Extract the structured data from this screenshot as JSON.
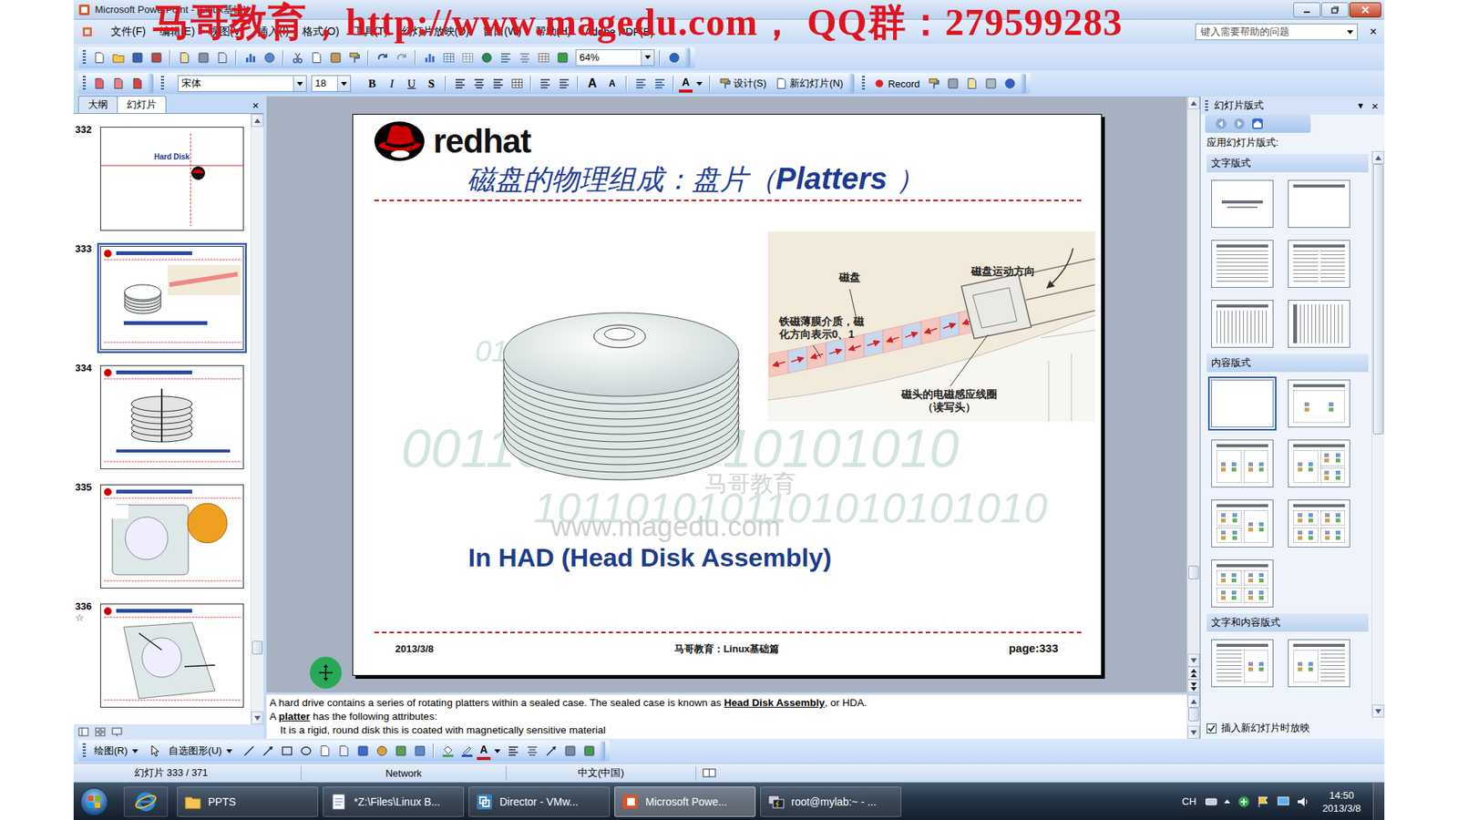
{
  "window": {
    "title": "Microsoft PowerPoint - [Linux基础]"
  },
  "watermark": "马哥教育，http://www.magedu.com， QQ群：279599283",
  "menu": [
    "文件(F)",
    "编辑(E)",
    "视图(V)",
    "插入(I)",
    "格式(O)",
    "工具(T)",
    "幻灯片放映(D)",
    "窗口(W)",
    "帮助(H)",
    "Adobe PDF(B)"
  ],
  "help_box": {
    "placeholder": "键入需要帮助的问题",
    "close": "×"
  },
  "standard_toolbar": {
    "zoom": "64%"
  },
  "format_toolbar": {
    "font": "宋体",
    "size": "18",
    "styles": [
      {
        "label": "B",
        "kind": "bold"
      },
      {
        "label": "I",
        "kind": "italic"
      },
      {
        "label": "U",
        "kind": "underline"
      },
      {
        "label": "S",
        "kind": "shadow"
      }
    ],
    "size_buttons": [
      "A",
      "A"
    ],
    "font_color": "A",
    "design": "设计(S)",
    "new_slide": "新幻灯片(N)",
    "record": "Record"
  },
  "sidebar": {
    "tabs": [
      {
        "label": "大纲",
        "selected": false
      },
      {
        "label": "幻灯片",
        "selected": true
      }
    ],
    "close": "×",
    "scroll_position": 0.9,
    "thumbnails": [
      {
        "number": "332",
        "kind": "section",
        "caption": "Hard Disk",
        "selected": false
      },
      {
        "number": "333",
        "kind": "platters",
        "selected": true
      },
      {
        "number": "334",
        "kind": "spindle",
        "selected": false
      },
      {
        "number": "335",
        "kind": "drive",
        "selected": false
      },
      {
        "number": "336",
        "kind": "actuator",
        "selected": false,
        "mark": "☆"
      }
    ]
  },
  "slide": {
    "logo": "redhat",
    "title": [
      {
        "text": "磁盘的物理组成：盘片（",
        "latin": false
      },
      {
        "text": "Platters",
        "latin": true
      },
      {
        "text": " ）",
        "latin": false
      }
    ],
    "wm_lines": [
      "0101101010101101",
      "0011010101010101010",
      "1011010101101010101010"
    ],
    "wm_brand": "马哥教育",
    "wm_site": "www.magedu.com",
    "diagram": {
      "disk": "磁盘",
      "direction": "磁盘运动方向",
      "medium": [
        "铁磁薄膜介质，磁",
        "化方向表示0、1"
      ],
      "head": [
        "磁头的电磁感应线圈",
        "（读写头）"
      ]
    },
    "caption": "In HAD (Head Disk Assembly)",
    "footer": {
      "date": "2013/3/8",
      "center": "马哥教育：Linux基础篇",
      "page": "page:333"
    },
    "scroll_position": 0.86
  },
  "notes": [
    {
      "indent": false,
      "parts": [
        {
          "text": "A hard drive contains a series of rotating platters within a sealed case. The sealed case is known as ",
          "bold": false
        },
        {
          "text": "Head Disk Assembly",
          "bold": true
        },
        {
          "text": ", or HDA.",
          "bold": false
        }
      ]
    },
    {
      "indent": false,
      "parts": [
        {
          "text": "A ",
          "bold": false
        },
        {
          "text": "platter",
          "bold": true
        },
        {
          "text": " has the following attributes:",
          "bold": false
        }
      ]
    },
    {
      "indent": true,
      "parts": [
        {
          "text": "It is a rigid, round disk this is coated with magnetically sensitive material",
          "bold": false
        }
      ]
    }
  ],
  "task_pane": {
    "title": "幻灯片版式",
    "dropdown": "▼",
    "close": "×",
    "label": "应用幻灯片版式:",
    "scroll_position": 0,
    "sections": [
      {
        "title": "文字版式",
        "layouts": [
          {
            "kind": "title-slide",
            "selected": false
          },
          {
            "kind": "title-only",
            "selected": false
          },
          {
            "kind": "list",
            "selected": false
          },
          {
            "kind": "two-list",
            "selected": false
          },
          {
            "kind": "vertical-list",
            "selected": false
          },
          {
            "kind": "vertical-title",
            "selected": false
          }
        ]
      },
      {
        "title": "内容版式",
        "layouts": [
          {
            "kind": "blank",
            "selected": true
          },
          {
            "kind": "content",
            "selected": false
          },
          {
            "kind": "two-content",
            "selected": false
          },
          {
            "kind": "content-stack",
            "selected": false
          },
          {
            "kind": "stack-content",
            "selected": false
          },
          {
            "kind": "four-content",
            "selected": false
          },
          {
            "kind": "four-content",
            "selected": false
          }
        ]
      },
      {
        "title": "文字和内容版式",
        "layouts": [
          {
            "kind": "list-content",
            "selected": false
          },
          {
            "kind": "content-list",
            "selected": false
          }
        ]
      }
    ],
    "show_on_insert": {
      "label": "插入新幻灯片时放映",
      "checked": true
    }
  },
  "draw_bar": {
    "draw": "绘图(R)",
    "autoshapes": "自选图形(U)",
    "font_color": "A"
  },
  "status_bar": {
    "slide": "幻灯片 333 / 371",
    "design": "Network",
    "language": "中文(中国)"
  },
  "taskbar": {
    "items": [
      {
        "label": "PPTS",
        "kind": "folder",
        "selected": false
      },
      {
        "label": "*Z:\\Files\\Linux B...",
        "kind": "notepad",
        "selected": false
      },
      {
        "label": "Director - VMw...",
        "kind": "vmware",
        "selected": false
      },
      {
        "label": "Microsoft Powe...",
        "kind": "powerpoint",
        "selected": true
      },
      {
        "label": "root@mylab:~ - ...",
        "kind": "putty",
        "selected": false
      }
    ],
    "lang": "CH",
    "time": "14:50",
    "date": "2013/3/8"
  }
}
